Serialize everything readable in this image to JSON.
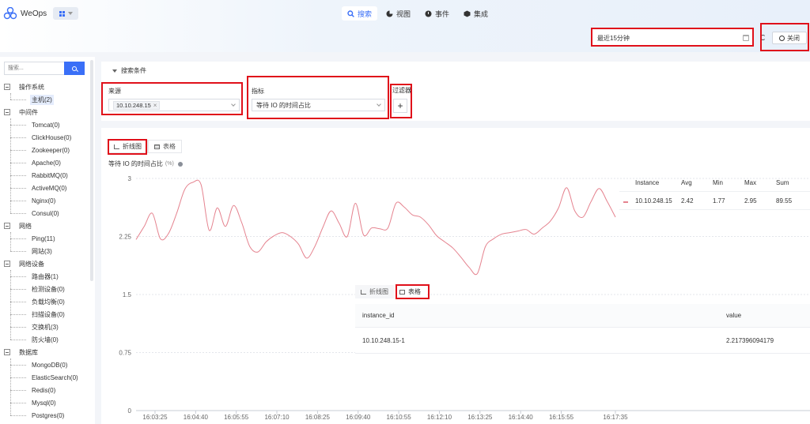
{
  "app": {
    "name": "WeOps"
  },
  "nav": [
    {
      "label": "搜索",
      "active": true
    },
    {
      "label": "视图",
      "active": false
    },
    {
      "label": "事件",
      "active": false
    },
    {
      "label": "集成",
      "active": false
    }
  ],
  "toolbar": {
    "time_range": "最近15分钟",
    "close_label": "关闭"
  },
  "sidebar": {
    "search_placeholder": "搜索...",
    "groups": [
      {
        "label": "操作系统",
        "children": [
          {
            "label": "主机(2)",
            "selected": true
          }
        ]
      },
      {
        "label": "中间件",
        "children": [
          {
            "label": "Tomcat(0)"
          },
          {
            "label": "ClickHouse(0)"
          },
          {
            "label": "Zookeeper(0)"
          },
          {
            "label": "Apache(0)"
          },
          {
            "label": "RabbitMQ(0)"
          },
          {
            "label": "ActiveMQ(0)"
          },
          {
            "label": "Nginx(0)"
          },
          {
            "label": "Consul(0)"
          }
        ]
      },
      {
        "label": "网络",
        "children": [
          {
            "label": "Ping(11)"
          },
          {
            "label": "网站(3)"
          }
        ]
      },
      {
        "label": "网络设备",
        "children": [
          {
            "label": "路由器(1)"
          },
          {
            "label": "检测设备(0)"
          },
          {
            "label": "负载均衡(0)"
          },
          {
            "label": "扫描设备(0)"
          },
          {
            "label": "交换机(3)"
          },
          {
            "label": "防火墙(0)"
          }
        ]
      },
      {
        "label": "数据库",
        "children": [
          {
            "label": "MongoDB(0)"
          },
          {
            "label": "ElasticSearch(0)"
          },
          {
            "label": "Redis(0)"
          },
          {
            "label": "Mysql(0)"
          },
          {
            "label": "Postgres(0)"
          }
        ]
      }
    ]
  },
  "conditions": {
    "title": "搜索条件",
    "source_label": "来源",
    "source_tag": "10.10.248.15",
    "metric_label": "指标",
    "metric_value": "等待 IO 的时间占比",
    "filter_label": "过滤器",
    "add_symbol": "+"
  },
  "chart_tabs": {
    "line": "折线图",
    "table": "表格"
  },
  "chart_title": "等待 IO 的时间占比",
  "chart_unit": "(%)",
  "chart_data": {
    "type": "line",
    "title": "等待 IO 的时间占比",
    "ylabel": "(%)",
    "ylim": [
      0,
      3
    ],
    "yticks": [
      "3",
      "2.25",
      "1.5",
      "0.75",
      "0"
    ],
    "xticks": [
      "16:03:25",
      "16:04:40",
      "16:05:55",
      "16:07:10",
      "16:08:25",
      "16:09:40",
      "16:10:55",
      "16:12:10",
      "16:13:25",
      "16:14:40",
      "16:15:55",
      "16:17:35"
    ],
    "grid": true,
    "series": [
      {
        "name": "10.10.248.15",
        "color": "#e5838f",
        "x": [
          "16:02:50",
          "16:03:05",
          "16:03:20",
          "16:03:35",
          "16:03:50",
          "16:04:05",
          "16:04:20",
          "16:04:35",
          "16:04:50",
          "16:05:05",
          "16:05:20",
          "16:05:35",
          "16:05:50",
          "16:06:05",
          "16:06:20",
          "16:06:35",
          "16:06:50",
          "16:07:05",
          "16:07:20",
          "16:07:35",
          "16:07:50",
          "16:08:05",
          "16:08:20",
          "16:08:35",
          "16:08:50",
          "16:09:05",
          "16:09:20",
          "16:09:35",
          "16:09:50",
          "16:10:05",
          "16:10:20",
          "16:10:35",
          "16:10:50",
          "16:11:05",
          "16:11:20",
          "16:11:35",
          "16:11:50",
          "16:12:05",
          "16:12:20",
          "16:12:35",
          "16:12:50",
          "16:13:05",
          "16:13:20",
          "16:13:35",
          "16:13:50",
          "16:14:05",
          "16:14:20",
          "16:14:35",
          "16:14:50",
          "16:15:05",
          "16:15:20",
          "16:15:35",
          "16:15:50",
          "16:16:05",
          "16:16:20",
          "16:16:35",
          "16:16:50",
          "16:17:05",
          "16:17:20",
          "16:17:35"
        ],
        "values": [
          2.21,
          2.38,
          2.55,
          2.22,
          2.29,
          2.55,
          2.86,
          2.95,
          2.92,
          2.33,
          2.62,
          2.38,
          2.65,
          2.43,
          2.12,
          2.05,
          2.18,
          2.26,
          2.3,
          2.25,
          2.15,
          1.97,
          2.12,
          2.37,
          2.58,
          2.42,
          2.25,
          2.68,
          2.27,
          2.36,
          2.35,
          2.36,
          2.68,
          2.63,
          2.53,
          2.5,
          2.4,
          2.26,
          2.18,
          2.1,
          1.98,
          1.85,
          1.77,
          2.12,
          2.22,
          2.28,
          2.3,
          2.32,
          2.34,
          2.28,
          2.36,
          2.45,
          2.62,
          2.88,
          2.58,
          2.5,
          2.7,
          2.87,
          2.7,
          2.5
        ]
      }
    ]
  },
  "summary_table": {
    "headers": [
      "Instance",
      "Avg",
      "Min",
      "Max",
      "Sum"
    ],
    "rows": [
      [
        "10.10.248.15",
        "2.42",
        "1.77",
        "2.95",
        "89.55"
      ]
    ]
  },
  "detail_table": {
    "headers": [
      "instance_id",
      "value"
    ],
    "rows": [
      [
        "10.10.248.15-1",
        "2.217396094179"
      ]
    ]
  }
}
